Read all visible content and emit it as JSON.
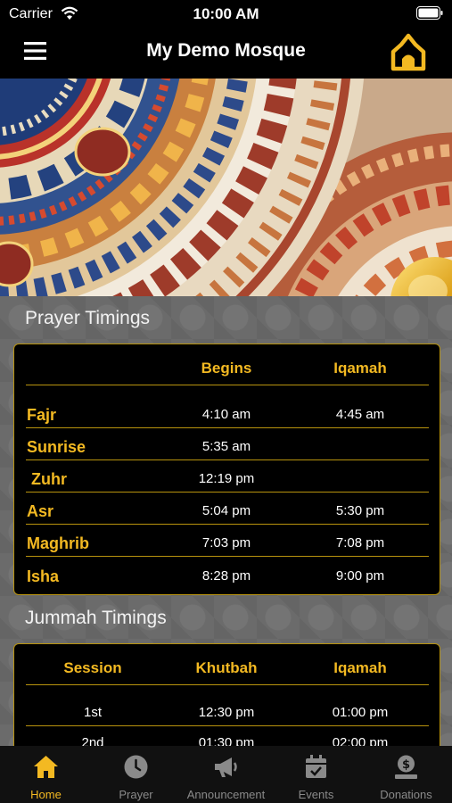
{
  "status_bar": {
    "carrier": "Carrier",
    "time": "10:00 AM"
  },
  "header": {
    "title": "My Demo Mosque"
  },
  "prayer": {
    "section_title": "Prayer Timings",
    "headers": [
      "Begins",
      "Iqamah"
    ],
    "rows": [
      {
        "name": "Fajr",
        "begins": "4:10 am",
        "iqamah": "4:45 am"
      },
      {
        "name": "Sunrise",
        "begins": "5:35 am",
        "iqamah": ""
      },
      {
        "name": " Zuhr",
        "begins": "12:19 pm",
        "iqamah": ""
      },
      {
        "name": "Asr",
        "begins": "5:04 pm",
        "iqamah": "5:30 pm"
      },
      {
        "name": "Maghrib",
        "begins": "7:03 pm",
        "iqamah": "7:08 pm"
      },
      {
        "name": "Isha",
        "begins": "8:28 pm",
        "iqamah": "9:00 pm"
      }
    ]
  },
  "jummah": {
    "section_title": "Jummah Timings",
    "headers": [
      "Session",
      "Khutbah",
      "Iqamah"
    ],
    "rows": [
      {
        "session": "1st",
        "khutbah": "12:30 pm",
        "iqamah": "01:00 pm"
      },
      {
        "session": "2nd",
        "khutbah": "01:30 pm",
        "iqamah": "02:00 pm"
      }
    ]
  },
  "tabs": [
    {
      "label": "Home",
      "icon": "home-icon",
      "active": true
    },
    {
      "label": "Prayer",
      "icon": "clock-icon",
      "active": false
    },
    {
      "label": "Announcement",
      "icon": "megaphone-icon",
      "active": false
    },
    {
      "label": "Events",
      "icon": "calendar-icon",
      "active": false
    },
    {
      "label": "Donations",
      "icon": "donation-icon",
      "active": false
    }
  ],
  "colors": {
    "accent": "#f3b922",
    "divider": "#b8930e",
    "background": "#000000",
    "tab_inactive": "#8a8a8a"
  }
}
